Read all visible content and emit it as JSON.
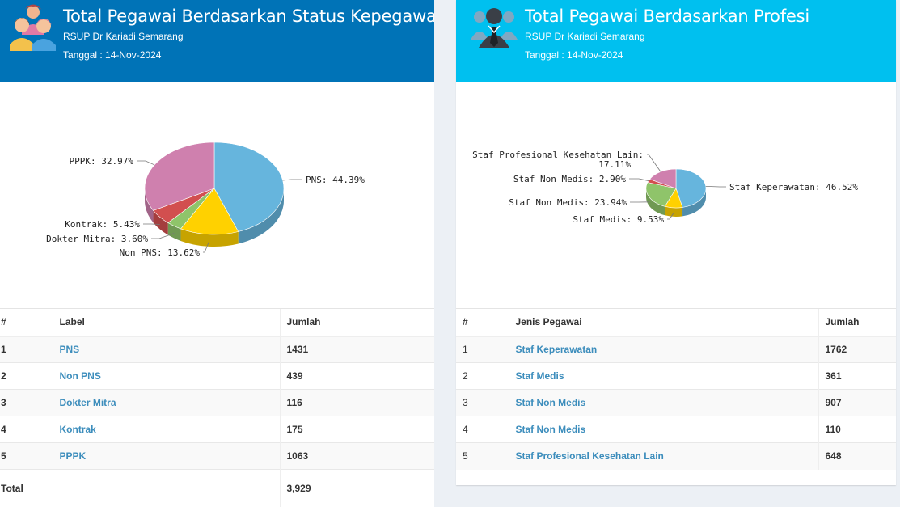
{
  "left": {
    "title": "Total Pegawai Berdasarkan Status Kepegawaian",
    "subtitle": "RSUP Dr Kariadi Semarang",
    "date": "Tanggal : 14-Nov-2024",
    "table": {
      "headers": [
        "#",
        "Label",
        "Jumlah"
      ],
      "rows": [
        {
          "no": "1",
          "label": "PNS",
          "value": "1431"
        },
        {
          "no": "2",
          "label": "Non PNS",
          "value": "439"
        },
        {
          "no": "3",
          "label": "Dokter Mitra",
          "value": "116"
        },
        {
          "no": "4",
          "label": "Kontrak",
          "value": "175"
        },
        {
          "no": "5",
          "label": "PPPK",
          "value": "1063"
        }
      ],
      "total_label": "Total",
      "total_value": "3,929"
    }
  },
  "right": {
    "title": "Total Pegawai Berdasarkan Profesi",
    "subtitle": "RSUP Dr Kariadi Semarang",
    "date": "Tanggal : 14-Nov-2024",
    "table": {
      "headers": [
        "#",
        "Jenis Pegawai",
        "Jumlah"
      ],
      "rows": [
        {
          "no": "1",
          "label": "Staf Keperawatan",
          "value": "1762"
        },
        {
          "no": "2",
          "label": "Staf Medis",
          "value": "361"
        },
        {
          "no": "3",
          "label": "Staf Non Medis",
          "value": "907"
        },
        {
          "no": "4",
          "label": "Staf Non Medis",
          "value": "110"
        },
        {
          "no": "5",
          "label": "Staf Profesional Kesehatan Lain",
          "value": "648"
        }
      ]
    }
  },
  "colors": {
    "left_header": "#0073b7",
    "right_header": "#00c0ef",
    "link": "#3c8dbc"
  },
  "icons": {
    "left_header": "people-group-icon",
    "right_header": "businessman-icon"
  },
  "chart_data": [
    {
      "type": "pie",
      "style": "3d",
      "title": "",
      "slices": [
        {
          "label": "PNS",
          "value": 44.39,
          "display": "PNS: 44.39%",
          "color": "#66b5dd"
        },
        {
          "label": "Non PNS",
          "value": 13.62,
          "display": "Non PNS: 13.62%",
          "color": "#ffd100"
        },
        {
          "label": "Dokter Mitra",
          "value": 3.6,
          "display": "Dokter Mitra: 3.60%",
          "color": "#8fc46a"
        },
        {
          "label": "Kontrak",
          "value": 5.43,
          "display": "Kontrak: 5.43%",
          "color": "#d24f4f"
        },
        {
          "label": "PPPK",
          "value": 32.97,
          "display": "PPPK: 32.97%",
          "color": "#cf80ae"
        }
      ]
    },
    {
      "type": "pie",
      "style": "3d",
      "title": "",
      "slices": [
        {
          "label": "Staf Keperawatan",
          "value": 46.52,
          "display": "Staf Keperawatan: 46.52%",
          "color": "#66b5dd"
        },
        {
          "label": "Staf Medis",
          "value": 9.53,
          "display": "Staf Medis: 9.53%",
          "color": "#ffd100"
        },
        {
          "label": "Staf Non Medis",
          "value": 23.94,
          "display": "Staf Non Medis: 23.94%",
          "color": "#8fc46a"
        },
        {
          "label": "Staf Non Medis",
          "value": 2.9,
          "display": "Staf Non Medis: 2.90%",
          "color": "#d24f4f"
        },
        {
          "label": "Staf Profesional Kesehatan Lain",
          "value": 17.11,
          "display": [
            "Staf Profesional Kesehatan Lain:",
            "17.11%"
          ],
          "color": "#cf80ae"
        }
      ]
    }
  ]
}
